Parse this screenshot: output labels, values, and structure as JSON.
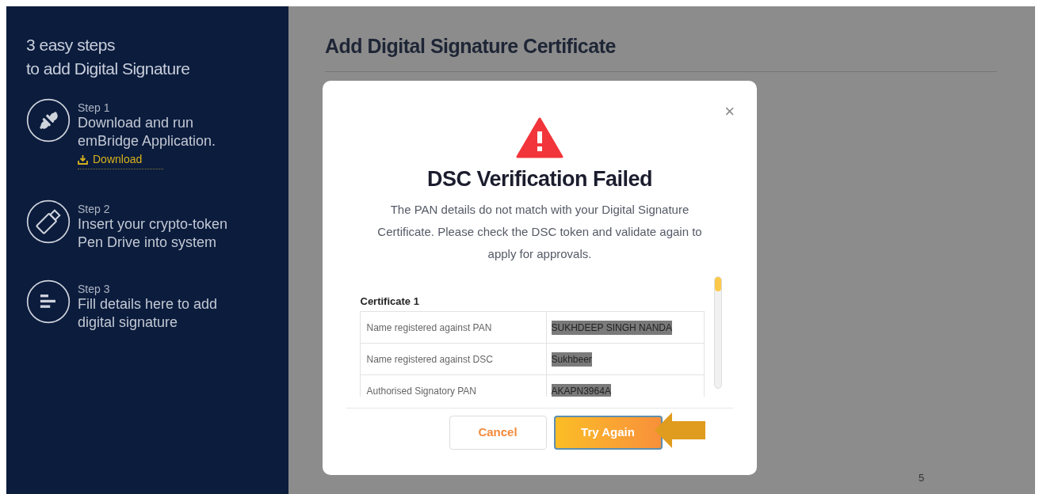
{
  "sidebar": {
    "heading_lines": [
      "3 easy steps",
      "to add Digital Signature"
    ],
    "steps": [
      {
        "kind": "plug",
        "label": "Step 1",
        "text_lines": [
          "Download and run",
          "emBridge Application."
        ],
        "link": "Download"
      },
      {
        "kind": "usb",
        "label": "Step 2",
        "text_lines": [
          "Insert your crypto-token",
          "Pen Drive into system"
        ]
      },
      {
        "kind": "form",
        "label": "Step 3",
        "text_lines": [
          "Fill details here to add",
          "digital signature"
        ]
      }
    ]
  },
  "page": {
    "title": "Add Digital Signature Certificate",
    "page_number": "5"
  },
  "dialog": {
    "close": "×",
    "title": "DSC Verification Failed",
    "message": "The PAN details do not match with your Digital Signature Certificate. Please check the DSC token and validate again to apply for approvals.",
    "certificate": {
      "title": "Certificate 1",
      "rows": [
        {
          "label": "Name registered against PAN",
          "value": "SUKHDEEP SINGH NANDA",
          "highlighted": true
        },
        {
          "label": "Name registered against DSC",
          "value": "Sukhbeer",
          "highlighted": true
        },
        {
          "label": "Authorised Signatory PAN",
          "value": "AKAPN3964A",
          "highlighted": true
        }
      ]
    },
    "buttons": [
      {
        "kind": "secondary",
        "label": "Cancel"
      },
      {
        "kind": "primary",
        "label": "Try Again"
      }
    ]
  },
  "annotation": {
    "kind": "arrow"
  }
}
